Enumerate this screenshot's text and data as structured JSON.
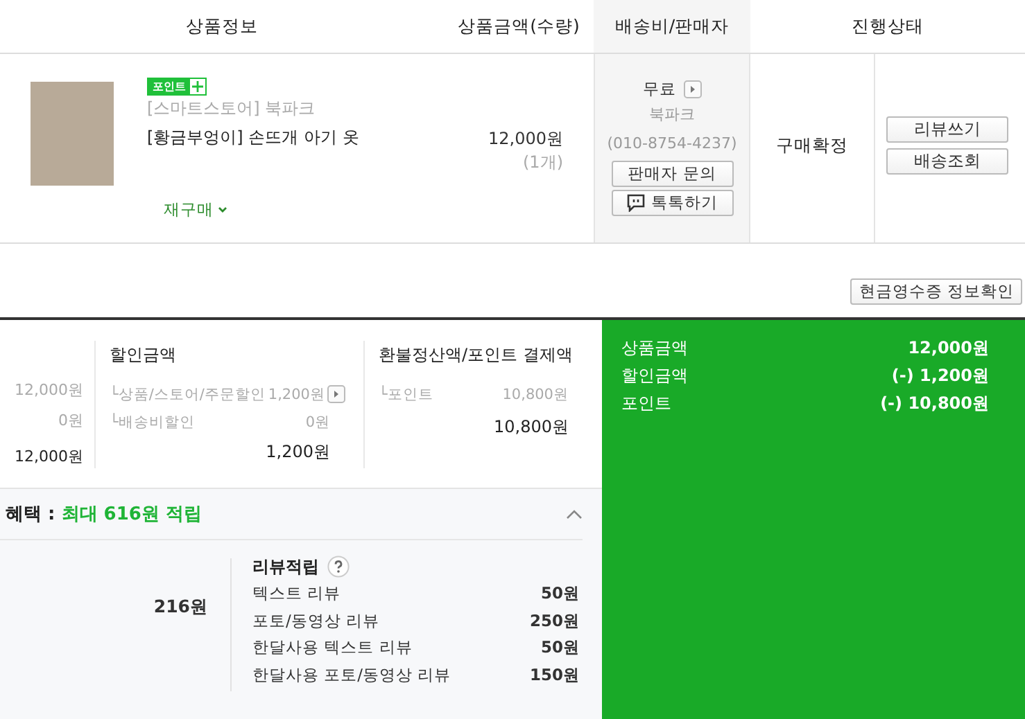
{
  "columns": [
    "상품정보",
    "상품금액(수량)",
    "배송비/판매자",
    "진행상태"
  ],
  "product": {
    "badge": "포인트",
    "store": "[스마트스토어] 북파크",
    "name": "[황금부엉이] 손뜨개 아기 옷",
    "rebuy": "재구매",
    "price": "12,000원",
    "quantity": "(1개)"
  },
  "shipping": {
    "fee": "무료",
    "seller": "북파크",
    "phone": "(010-8754-4237)",
    "buttons": [
      {
        "kind": "plain",
        "label": "판매자 문의"
      },
      {
        "kind": "chat",
        "label": "톡톡하기"
      }
    ]
  },
  "status": {
    "text": "구매확정",
    "buttons": [
      "리뷰쓰기",
      "배송조회"
    ]
  },
  "receipt_button": "현금영수증 정보확인",
  "amounts": [
    {
      "values": [
        "12,000원",
        "0원"
      ],
      "total": "12,000원"
    },
    {
      "title": "할인금액",
      "rows": [
        {
          "label": "└상품/스토어/주문할인",
          "value": "1,200원",
          "detail": true
        },
        {
          "label": "└배송비할인",
          "value": "0원",
          "detail": false
        }
      ],
      "total": "1,200원"
    },
    {
      "title": "환불정산액/포인트 결제액",
      "rows": [
        {
          "label": "└포인트",
          "value": "10,800원",
          "detail": false
        }
      ],
      "total": "10,800원"
    }
  ],
  "summary": [
    {
      "label": "상품금액",
      "value": "12,000원"
    },
    {
      "label": "할인금액",
      "value": "(-) 1,200원"
    },
    {
      "label": "포인트",
      "value": "(-) 10,800원"
    }
  ],
  "benefit": {
    "title": "혜택 :",
    "highlight": "최대 616원 적립",
    "expanded": true,
    "amount": "216원",
    "review": {
      "title": "리뷰적립",
      "rows": [
        {
          "label": "텍스트 리뷰",
          "value": "50원"
        },
        {
          "label": "포토/동영상 리뷰",
          "value": "250원"
        },
        {
          "label": "한달사용 텍스트 리뷰",
          "value": "50원"
        },
        {
          "label": "한달사용 포토/동영상 리뷰",
          "value": "150원"
        }
      ]
    }
  }
}
